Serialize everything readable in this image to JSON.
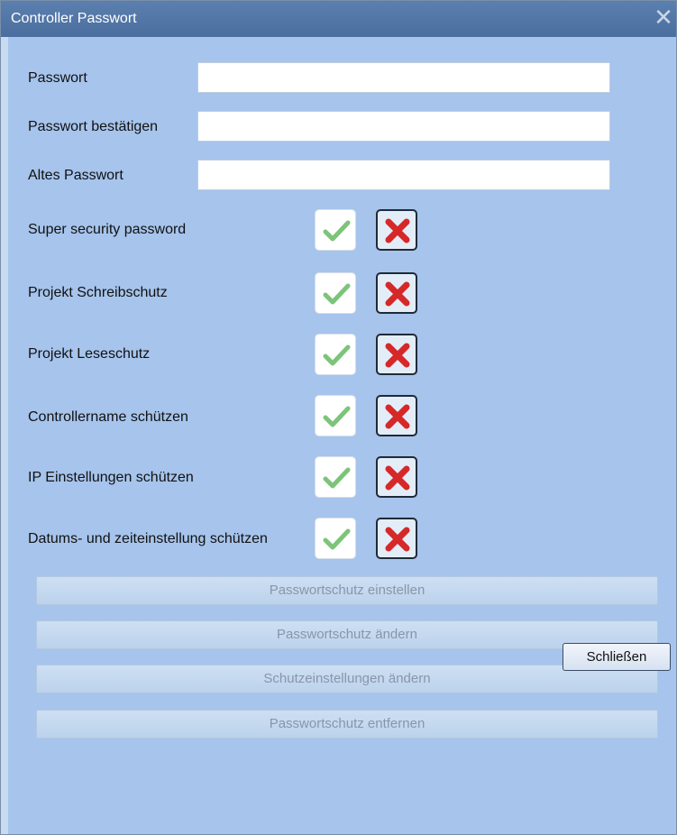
{
  "window": {
    "title": "Controller Passwort",
    "close_glyph": "✕"
  },
  "fields": [
    {
      "label": "Passwort",
      "value": ""
    },
    {
      "label": "Passwort bestätigen",
      "value": ""
    },
    {
      "label": "Altes Passwort",
      "value": ""
    }
  ],
  "options": [
    {
      "label": "Super security password",
      "yes_icon": "check-icon",
      "no_icon": "x-icon"
    },
    {
      "label": "Projekt Schreibschutz",
      "yes_icon": "check-icon",
      "no_icon": "x-icon"
    },
    {
      "label": "Projekt Leseschutz",
      "yes_icon": "check-icon",
      "no_icon": "x-icon"
    },
    {
      "label": "Controllername schützen",
      "yes_icon": "check-icon",
      "no_icon": "x-icon"
    },
    {
      "label": "IP Einstellungen schützen",
      "yes_icon": "check-icon",
      "no_icon": "x-icon"
    },
    {
      "label": "Datums- und zeiteinstellung schützen",
      "yes_icon": "check-icon",
      "no_icon": "x-icon"
    }
  ],
  "actions": [
    {
      "label": "Passwortschutz einstellen",
      "enabled": false
    },
    {
      "label": "Passwortschutz ändern",
      "enabled": false
    },
    {
      "label": "Schutzeinstellungen ändern",
      "enabled": false
    },
    {
      "label": "Passwortschutz entfernen",
      "enabled": false
    }
  ],
  "footer": {
    "close_label": "Schließen"
  },
  "colors": {
    "titlebar": "#4a6f9f",
    "body": "#a6c4ec",
    "check": "#7cc47a",
    "cross": "#d62828"
  }
}
